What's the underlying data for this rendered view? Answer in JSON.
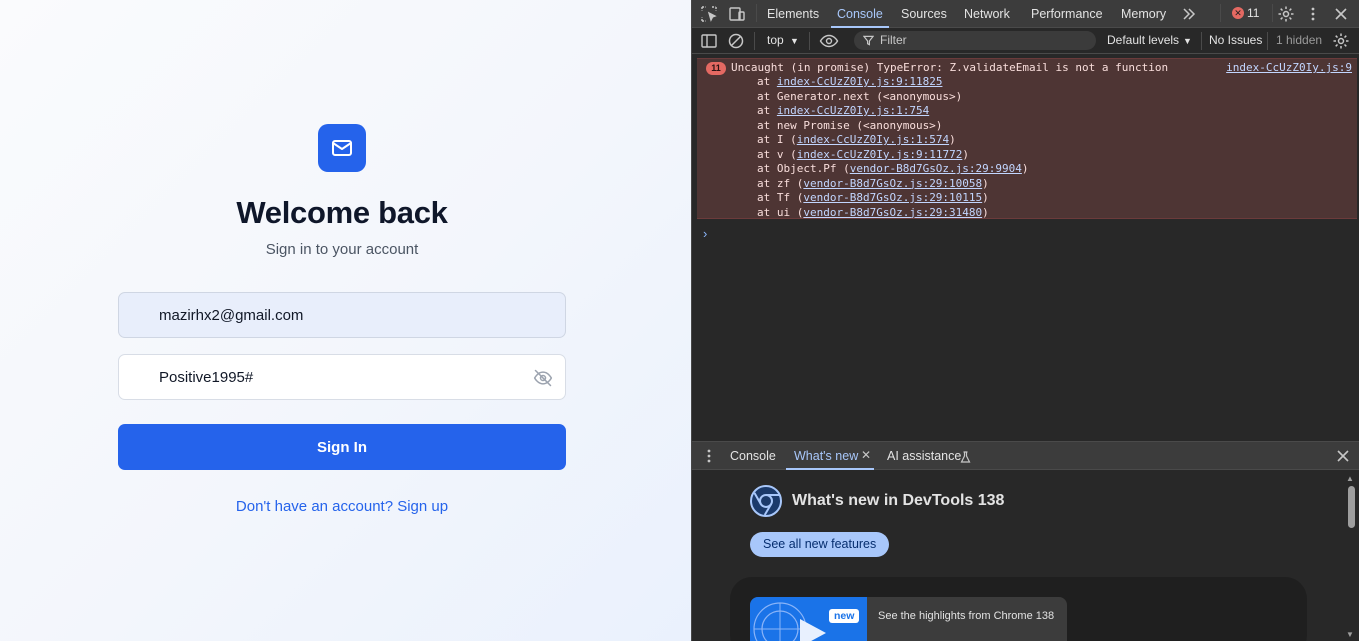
{
  "app": {
    "title": "Welcome back",
    "subtitle": "Sign in to your account",
    "email_value": "mazirhx2@gmail.com",
    "password_value": "Positive1995#",
    "signin_label": "Sign In",
    "signup_text": "Don't have an account? Sign up",
    "accent_color": "#2563eb",
    "logo_icon": "mail-icon"
  },
  "devtools": {
    "tabs": [
      {
        "label": "Elements"
      },
      {
        "label": "Console",
        "active": true
      },
      {
        "label": "Sources"
      },
      {
        "label": "Network"
      },
      {
        "label": "Performance"
      },
      {
        "label": "Memory"
      }
    ],
    "error_count": "11",
    "toolbar": {
      "context": "top",
      "filter_placeholder": "Filter",
      "levels": "Default levels",
      "issues": "No Issues",
      "hidden": "1 hidden"
    },
    "console": {
      "error_badge": "11",
      "message": "Uncaught (in promise) TypeError: Z.validateEmail is not a function",
      "source": "index-CcUzZ0Iy.js:9",
      "stack": [
        {
          "prefix": "at ",
          "link": "index-CcUzZ0Iy.js:9:11825",
          "suffix": ""
        },
        {
          "prefix": "at Generator.next (<anonymous>)",
          "link": "",
          "suffix": ""
        },
        {
          "prefix": "at ",
          "link": "index-CcUzZ0Iy.js:1:754",
          "suffix": ""
        },
        {
          "prefix": "at new Promise (<anonymous>)",
          "link": "",
          "suffix": ""
        },
        {
          "prefix": "at I (",
          "link": "index-CcUzZ0Iy.js:1:574",
          "suffix": ")"
        },
        {
          "prefix": "at v (",
          "link": "index-CcUzZ0Iy.js:9:11772",
          "suffix": ")"
        },
        {
          "prefix": "at Object.Pf (",
          "link": "vendor-B8d7GsOz.js:29:9904",
          "suffix": ")"
        },
        {
          "prefix": "at zf (",
          "link": "vendor-B8d7GsOz.js:29:10058",
          "suffix": ")"
        },
        {
          "prefix": "at Tf (",
          "link": "vendor-B8d7GsOz.js:29:10115",
          "suffix": ")"
        },
        {
          "prefix": "at ui (",
          "link": "vendor-B8d7GsOz.js:29:31480",
          "suffix": ")"
        }
      ],
      "prompt_glyph": "›"
    },
    "drawer": {
      "tabs": [
        {
          "label": "Console"
        },
        {
          "label": "What's new",
          "active": true
        },
        {
          "label": "AI assistance"
        }
      ],
      "whats_new_title": "What's new in DevTools 138",
      "see_all": "See all new features",
      "new_tag": "new",
      "highlight_text": "See the highlights from Chrome 138"
    }
  }
}
